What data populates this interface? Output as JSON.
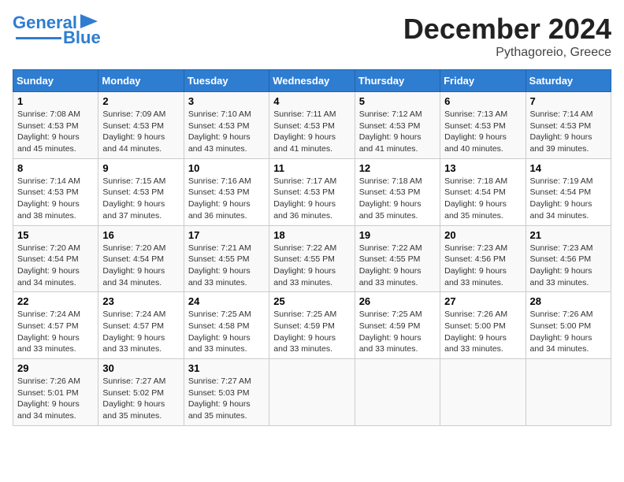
{
  "logo": {
    "line1": "General",
    "line2": "Blue"
  },
  "title": "December 2024",
  "location": "Pythagoreio, Greece",
  "weekdays": [
    "Sunday",
    "Monday",
    "Tuesday",
    "Wednesday",
    "Thursday",
    "Friday",
    "Saturday"
  ],
  "weeks": [
    [
      {
        "day": "1",
        "info": "Sunrise: 7:08 AM\nSunset: 4:53 PM\nDaylight: 9 hours\nand 45 minutes."
      },
      {
        "day": "2",
        "info": "Sunrise: 7:09 AM\nSunset: 4:53 PM\nDaylight: 9 hours\nand 44 minutes."
      },
      {
        "day": "3",
        "info": "Sunrise: 7:10 AM\nSunset: 4:53 PM\nDaylight: 9 hours\nand 43 minutes."
      },
      {
        "day": "4",
        "info": "Sunrise: 7:11 AM\nSunset: 4:53 PM\nDaylight: 9 hours\nand 41 minutes."
      },
      {
        "day": "5",
        "info": "Sunrise: 7:12 AM\nSunset: 4:53 PM\nDaylight: 9 hours\nand 41 minutes."
      },
      {
        "day": "6",
        "info": "Sunrise: 7:13 AM\nSunset: 4:53 PM\nDaylight: 9 hours\nand 40 minutes."
      },
      {
        "day": "7",
        "info": "Sunrise: 7:14 AM\nSunset: 4:53 PM\nDaylight: 9 hours\nand 39 minutes."
      }
    ],
    [
      {
        "day": "8",
        "info": "Sunrise: 7:14 AM\nSunset: 4:53 PM\nDaylight: 9 hours\nand 38 minutes."
      },
      {
        "day": "9",
        "info": "Sunrise: 7:15 AM\nSunset: 4:53 PM\nDaylight: 9 hours\nand 37 minutes."
      },
      {
        "day": "10",
        "info": "Sunrise: 7:16 AM\nSunset: 4:53 PM\nDaylight: 9 hours\nand 36 minutes."
      },
      {
        "day": "11",
        "info": "Sunrise: 7:17 AM\nSunset: 4:53 PM\nDaylight: 9 hours\nand 36 minutes."
      },
      {
        "day": "12",
        "info": "Sunrise: 7:18 AM\nSunset: 4:53 PM\nDaylight: 9 hours\nand 35 minutes."
      },
      {
        "day": "13",
        "info": "Sunrise: 7:18 AM\nSunset: 4:54 PM\nDaylight: 9 hours\nand 35 minutes."
      },
      {
        "day": "14",
        "info": "Sunrise: 7:19 AM\nSunset: 4:54 PM\nDaylight: 9 hours\nand 34 minutes."
      }
    ],
    [
      {
        "day": "15",
        "info": "Sunrise: 7:20 AM\nSunset: 4:54 PM\nDaylight: 9 hours\nand 34 minutes."
      },
      {
        "day": "16",
        "info": "Sunrise: 7:20 AM\nSunset: 4:54 PM\nDaylight: 9 hours\nand 34 minutes."
      },
      {
        "day": "17",
        "info": "Sunrise: 7:21 AM\nSunset: 4:55 PM\nDaylight: 9 hours\nand 33 minutes."
      },
      {
        "day": "18",
        "info": "Sunrise: 7:22 AM\nSunset: 4:55 PM\nDaylight: 9 hours\nand 33 minutes."
      },
      {
        "day": "19",
        "info": "Sunrise: 7:22 AM\nSunset: 4:55 PM\nDaylight: 9 hours\nand 33 minutes."
      },
      {
        "day": "20",
        "info": "Sunrise: 7:23 AM\nSunset: 4:56 PM\nDaylight: 9 hours\nand 33 minutes."
      },
      {
        "day": "21",
        "info": "Sunrise: 7:23 AM\nSunset: 4:56 PM\nDaylight: 9 hours\nand 33 minutes."
      }
    ],
    [
      {
        "day": "22",
        "info": "Sunrise: 7:24 AM\nSunset: 4:57 PM\nDaylight: 9 hours\nand 33 minutes."
      },
      {
        "day": "23",
        "info": "Sunrise: 7:24 AM\nSunset: 4:57 PM\nDaylight: 9 hours\nand 33 minutes."
      },
      {
        "day": "24",
        "info": "Sunrise: 7:25 AM\nSunset: 4:58 PM\nDaylight: 9 hours\nand 33 minutes."
      },
      {
        "day": "25",
        "info": "Sunrise: 7:25 AM\nSunset: 4:59 PM\nDaylight: 9 hours\nand 33 minutes."
      },
      {
        "day": "26",
        "info": "Sunrise: 7:25 AM\nSunset: 4:59 PM\nDaylight: 9 hours\nand 33 minutes."
      },
      {
        "day": "27",
        "info": "Sunrise: 7:26 AM\nSunset: 5:00 PM\nDaylight: 9 hours\nand 33 minutes."
      },
      {
        "day": "28",
        "info": "Sunrise: 7:26 AM\nSunset: 5:00 PM\nDaylight: 9 hours\nand 34 minutes."
      }
    ],
    [
      {
        "day": "29",
        "info": "Sunrise: 7:26 AM\nSunset: 5:01 PM\nDaylight: 9 hours\nand 34 minutes."
      },
      {
        "day": "30",
        "info": "Sunrise: 7:27 AM\nSunset: 5:02 PM\nDaylight: 9 hours\nand 35 minutes."
      },
      {
        "day": "31",
        "info": "Sunrise: 7:27 AM\nSunset: 5:03 PM\nDaylight: 9 hours\nand 35 minutes."
      },
      null,
      null,
      null,
      null
    ]
  ]
}
